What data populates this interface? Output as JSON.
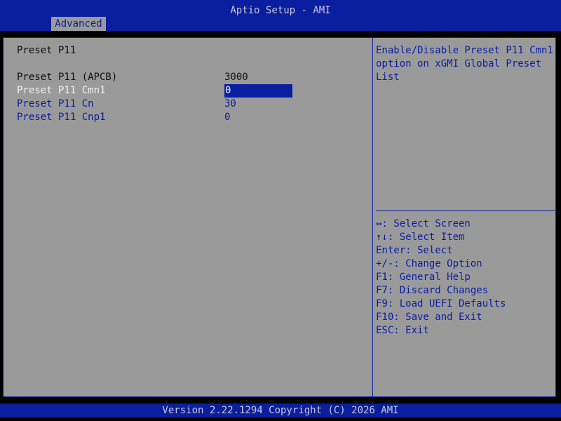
{
  "header": {
    "title": "Aptio Setup - AMI",
    "active_tab": "Advanced"
  },
  "page": {
    "section_title": "Preset P11",
    "items": [
      {
        "label": "Preset P11 (APCB)",
        "value": "3000"
      },
      {
        "label": "Preset P11 Cmn1",
        "value": "0"
      },
      {
        "label": "Preset P11 Cn",
        "value": "30"
      },
      {
        "label": "Preset P11 Cnp1",
        "value": "0"
      }
    ]
  },
  "help": {
    "description_lines": [
      "Enable/Disable Preset P11 Cmn1",
      "option on xGMI Global Preset",
      "List"
    ],
    "keys": [
      "↔: Select Screen",
      "↑↓: Select Item",
      "Enter: Select",
      "+/-: Change Option",
      "F1: General Help",
      "F7: Discard Changes",
      "F9: Load UEFI Defaults",
      "F10: Save and Exit",
      "ESC: Exit"
    ]
  },
  "footer": {
    "text": "Version 2.22.1294 Copyright (C) 2026 AMI"
  },
  "colors": {
    "bios_blue": "#0a1ea0",
    "panel_gray": "#9a9a9a",
    "selected_text": "#f0f0f0"
  }
}
